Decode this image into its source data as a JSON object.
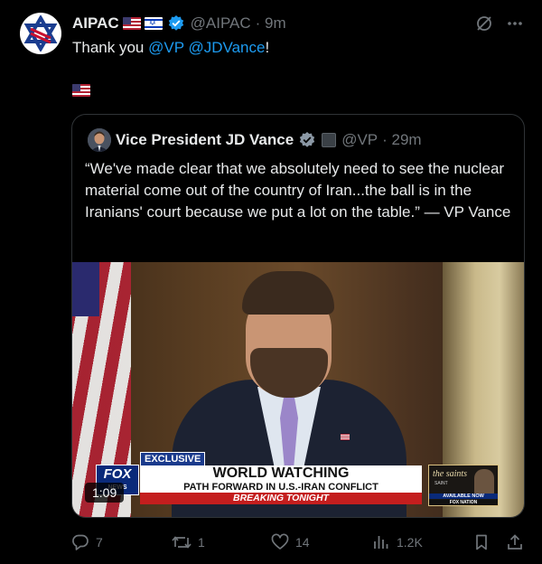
{
  "tweet": {
    "author_name": "AIPAC",
    "author_handle": "@AIPAC",
    "time": "· 9m",
    "text_prefix": "Thank you ",
    "mention_1": "@VP",
    "mention_2": "@JDVance",
    "text_suffix": "!",
    "flag_line": "🇺🇸"
  },
  "quote": {
    "author_name": "Vice President JD Vance",
    "author_handle": "@VP",
    "time": "· 29m",
    "text": "“We've made clear that we absolutely need to see the nuclear material come out of the country of Iran...the ball is in the Iranians' court because we put a lot on the table.” — VP Vance",
    "video": {
      "duration": "1:09",
      "chyron_tag": "EXCLUSIVE",
      "headline": "WORLD WATCHING",
      "subheadline": "PATH FORWARD IN U.S.-IRAN CONFLICT",
      "ticker": "BREAKING TONIGHT",
      "network_logo": "FOX",
      "network_sub": "NEWS",
      "promo_title": "the saints",
      "promo_sub": "SAINT",
      "promo_available": "AVAILABLE NOW",
      "promo_brand": "FOX NATION"
    }
  },
  "actions": {
    "replies": "7",
    "reposts": "1",
    "likes": "14",
    "views": "1.2K"
  },
  "colors": {
    "background": "#000000",
    "text": "#e7e9ea",
    "muted": "#71767b",
    "link": "#1d9bf0",
    "border": "#2f3336",
    "verified": "#1d9bf0"
  },
  "icons": [
    "grok-icon",
    "more-icon",
    "reply-icon",
    "repost-icon",
    "like-icon",
    "views-icon",
    "bookmark-icon",
    "share-icon",
    "verified-badge-icon"
  ]
}
